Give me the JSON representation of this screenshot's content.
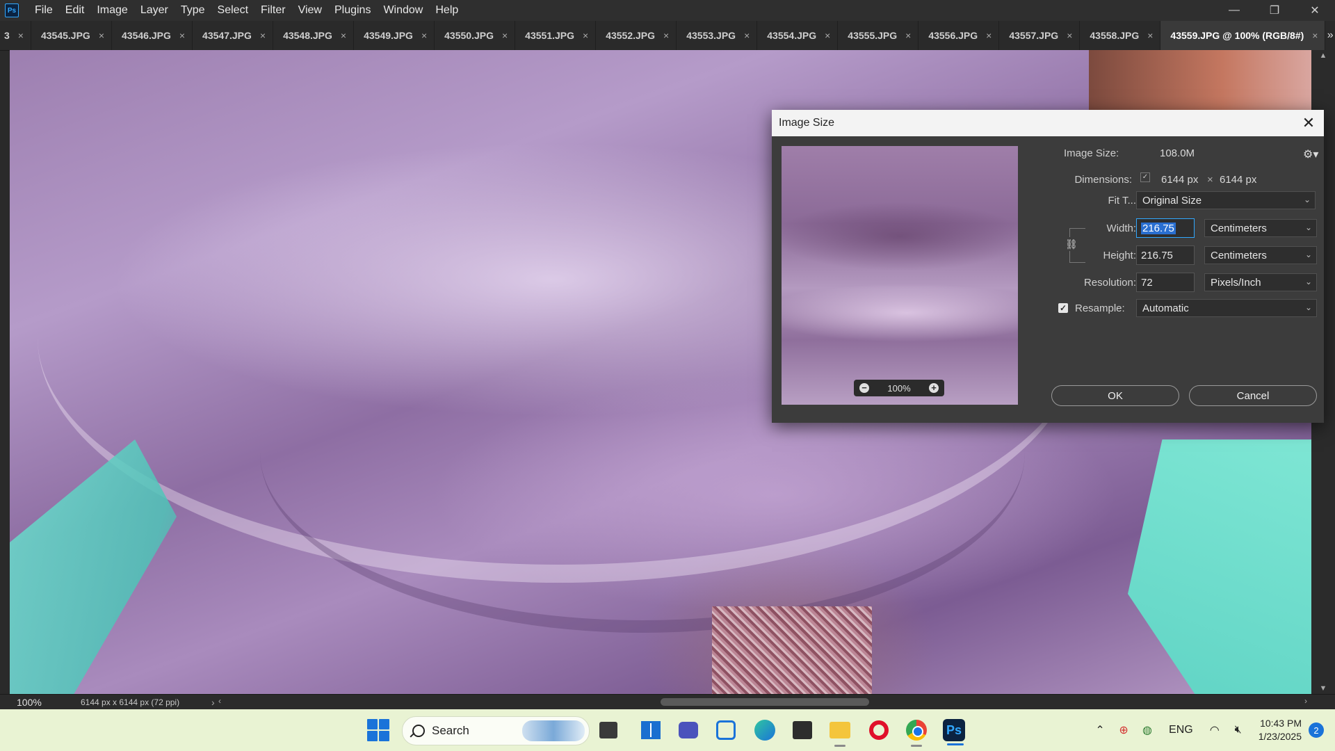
{
  "menubar": {
    "logo": "Ps",
    "items": [
      "File",
      "Edit",
      "Image",
      "Layer",
      "Type",
      "Select",
      "Filter",
      "View",
      "Plugins",
      "Window",
      "Help"
    ],
    "window_controls": {
      "minimize": "—",
      "restore": "❐",
      "close": "✕"
    }
  },
  "tabs": {
    "partial_label": "3",
    "items": [
      "43545.JPG",
      "43546.JPG",
      "43547.JPG",
      "43548.JPG",
      "43549.JPG",
      "43550.JPG",
      "43551.JPG",
      "43552.JPG",
      "43553.JPG",
      "43554.JPG",
      "43555.JPG",
      "43556.JPG",
      "43557.JPG",
      "43558.JPG"
    ],
    "active": "43559.JPG @ 100% (RGB/8#)",
    "close_glyph": "×",
    "overflow_glyph": "»"
  },
  "statusbar": {
    "zoom": "100%",
    "doc_info": "6144 px x 6144 px (72 ppi)",
    "arrow": "›",
    "hscroll_left": "‹",
    "hscroll_right": "›"
  },
  "dialog": {
    "title": "Image Size",
    "close": "✕",
    "image_size_label": "Image Size:",
    "image_size_value": "108.0M",
    "dimensions_label": "Dimensions:",
    "dim_width": "6144 px",
    "dim_x": "×",
    "dim_height": "6144 px",
    "fit_label": "Fit T...",
    "fit_value": "Original Size",
    "width_label": "Width:",
    "width_value": "216.75",
    "width_unit": "Centimeters",
    "height_label": "Height:",
    "height_value": "216.75",
    "height_unit": "Centimeters",
    "resolution_label": "Resolution:",
    "resolution_value": "72",
    "resolution_unit": "Pixels/Inch",
    "resample_label": "Resample:",
    "resample_checked": true,
    "resample_value": "Automatic",
    "preview_zoom": "100%",
    "ok_label": "OK",
    "cancel_label": "Cancel",
    "icons": {
      "gear": "gear-icon",
      "link": "link-icon",
      "chevron": "chevron-down-icon"
    }
  },
  "taskbar": {
    "search_label": "Search",
    "apps": [
      "task-view",
      "widgets",
      "meet",
      "snipping-tool",
      "edge",
      "store",
      "file-explorer",
      "opera",
      "chrome",
      "photoshop"
    ],
    "photoshop_label": "Ps",
    "tray": {
      "language": "ENG",
      "time": "10:43 PM",
      "date": "1/23/2025",
      "notifications": "2"
    }
  },
  "colors": {
    "accent": "#31a8ff",
    "taskbar_bg": "#e9f3d3",
    "dialog_bg": "#3c3c3c"
  }
}
